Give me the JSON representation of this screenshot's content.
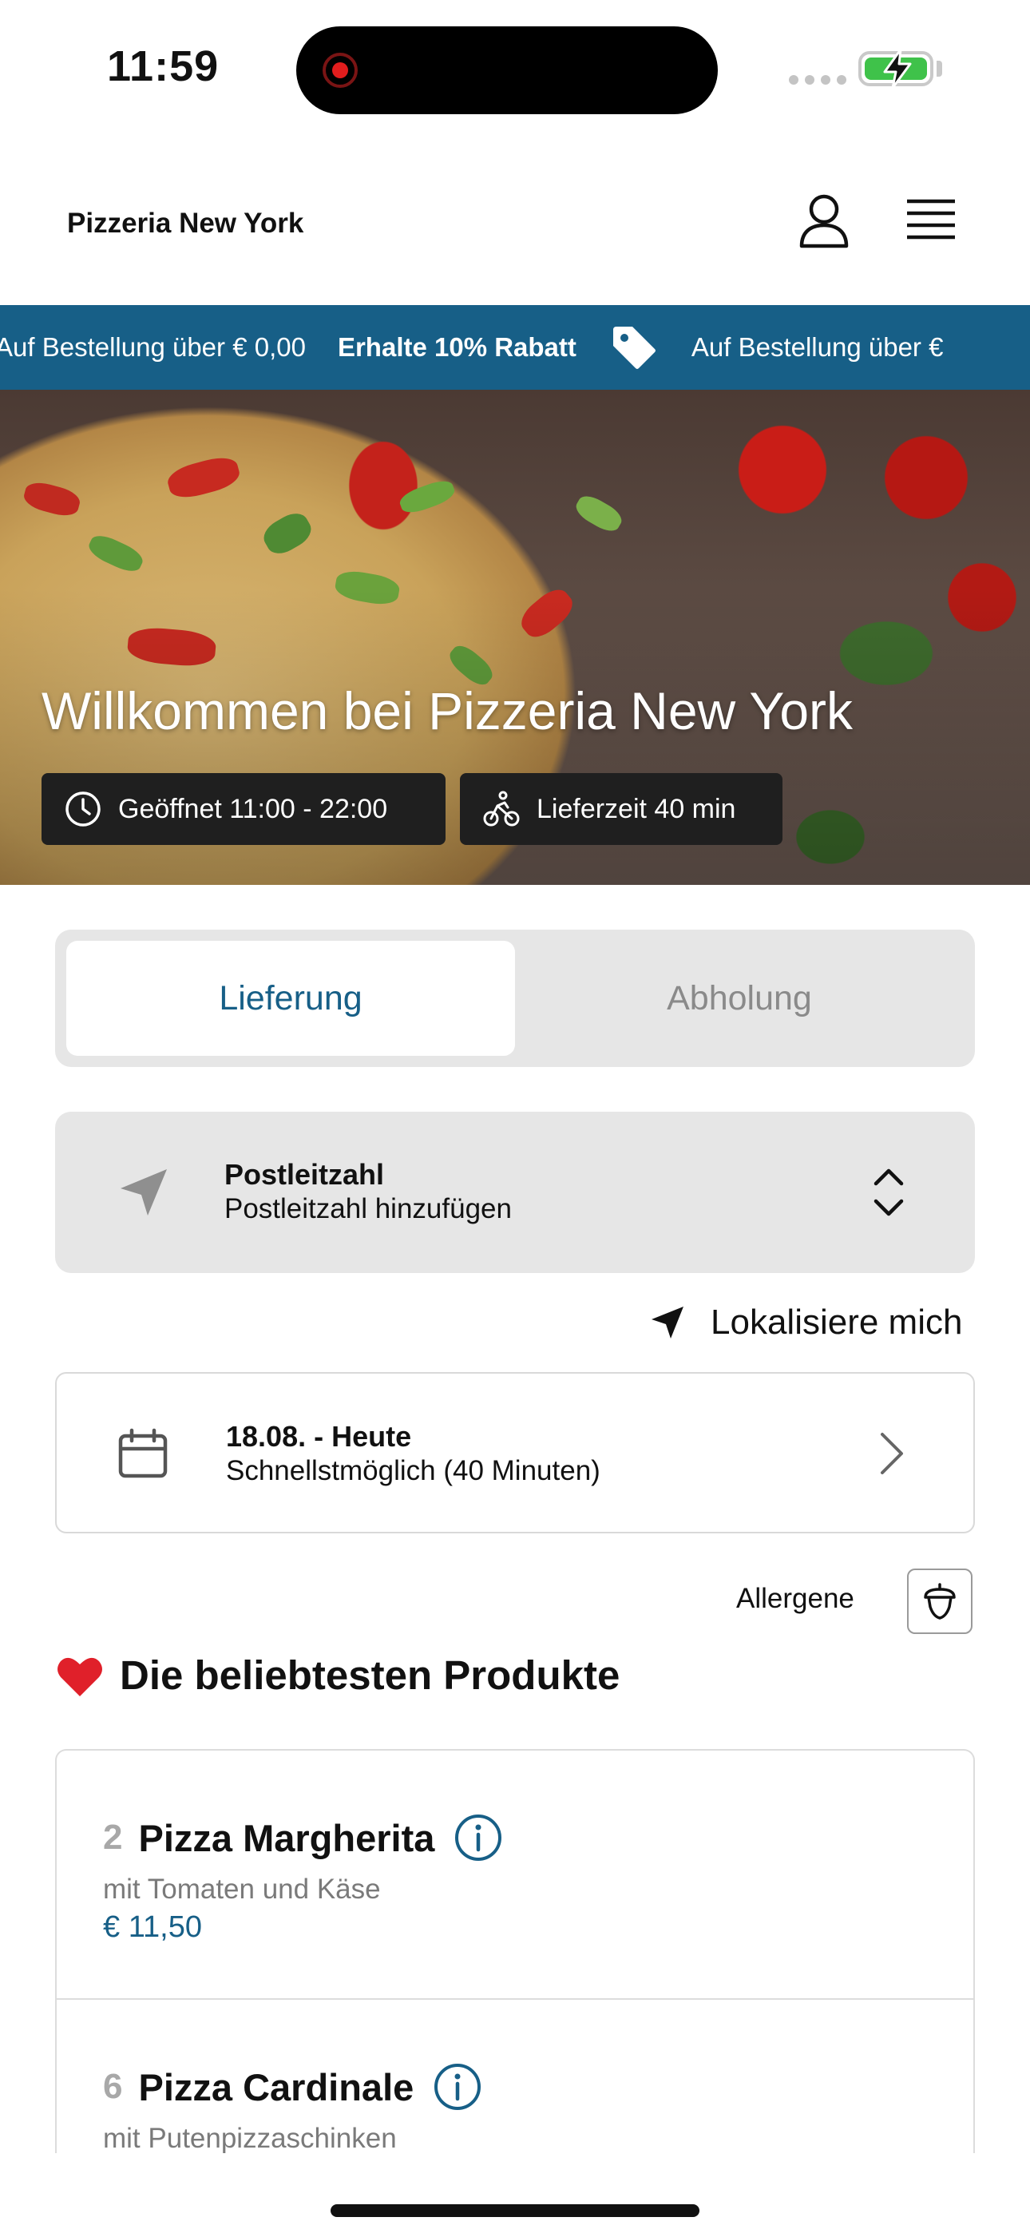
{
  "status_bar": {
    "time": "11:59"
  },
  "header": {
    "brand": "Pizzeria New York"
  },
  "promo": {
    "segment_1": "Auf Bestellung über € 0,00",
    "segment_2": "Erhalte 10% Rabatt",
    "segment_3": "Auf Bestellung über €"
  },
  "hero": {
    "title": "Willkommen bei Pizzeria New York",
    "opening_hours": "Geöffnet 11:00 - 22:00",
    "delivery_time": "Lieferzeit 40 min"
  },
  "order_mode": {
    "options": [
      "Lieferung",
      "Abholung"
    ],
    "selected": "Lieferung"
  },
  "postal": {
    "title": "Postleitzahl",
    "placeholder": "Postleitzahl hinzufügen"
  },
  "locate": {
    "label": "Lokalisiere mich"
  },
  "schedule": {
    "date": "18.08. - Heute",
    "time": "Schnellstmöglich (40 Minuten)"
  },
  "allergens": {
    "label": "Allergene"
  },
  "popular": {
    "title": "Die beliebtesten Produkte",
    "items": [
      {
        "number": "2",
        "name": "Pizza Margherita",
        "description": "mit Tomaten und Käse",
        "price": "€ 11,50"
      },
      {
        "number": "6",
        "name": "Pizza Cardinale",
        "description": "mit Putenpizzaschinken",
        "price": ""
      }
    ]
  },
  "colors": {
    "accent": "#175f87",
    "surface": "#e6e6e6",
    "chip": "#1f1f1f"
  },
  "icons": [
    "user-icon",
    "menu-icon",
    "tag-icon",
    "clock-icon",
    "bike-icon",
    "navigation-arrow-icon",
    "updown-chevron-icon",
    "calendar-icon",
    "chevron-right-icon",
    "acorn-icon",
    "heart-icon",
    "info-icon"
  ]
}
